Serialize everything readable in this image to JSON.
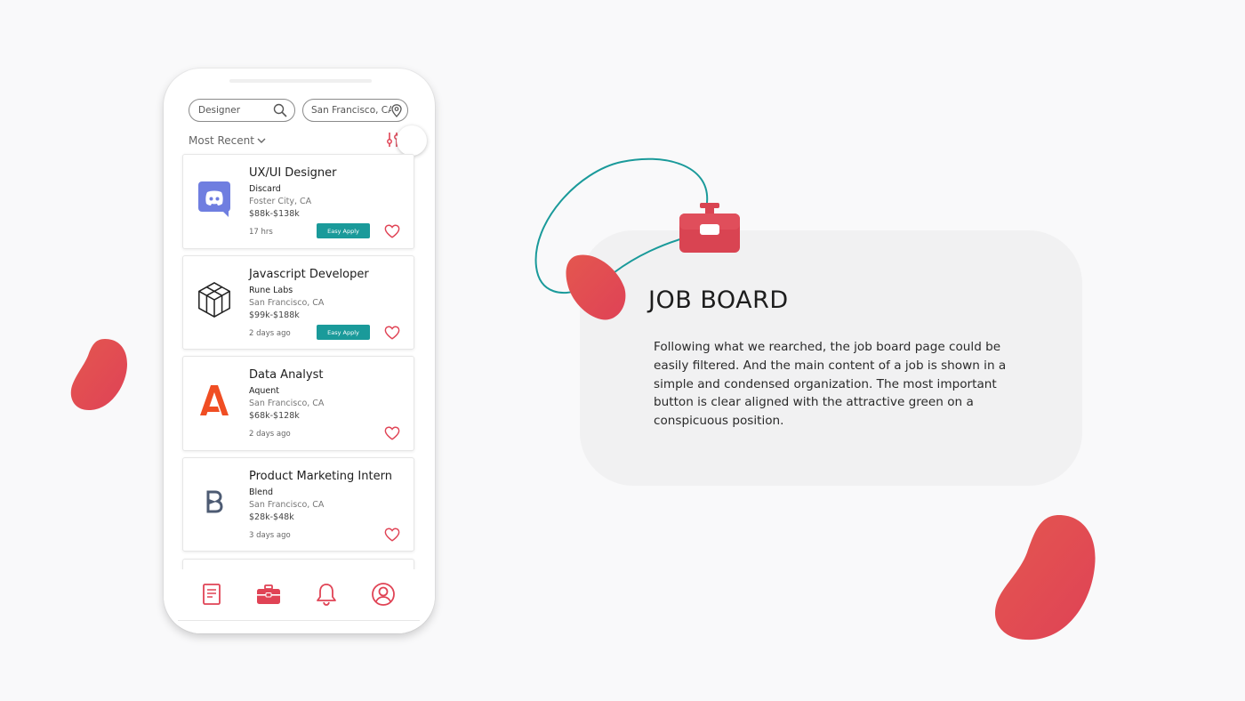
{
  "colors": {
    "accent": "#e04355",
    "teal": "#1a9a9a",
    "card_bg": "#f1f1f2"
  },
  "search": {
    "keyword": "Designer",
    "location": "San Francisco, CA"
  },
  "sort": {
    "label": "Most Recent"
  },
  "jobs": [
    {
      "title": "UX/UI Designer",
      "company": "Discard",
      "location": "Foster City, CA",
      "salary": "$88k-$138k",
      "posted": "17 hrs",
      "apply_label": "Easy Apply",
      "logo": "discord-icon"
    },
    {
      "title": "Javascript Developer",
      "company": "Rune Labs",
      "location": "San Francisco, CA",
      "salary": "$99k-$188k",
      "posted": "2 days ago",
      "apply_label": "Easy Apply",
      "logo": "rune-labs-icon"
    },
    {
      "title": "Data Analyst",
      "company": "Aquent",
      "location": "San Francisco, CA",
      "salary": "$68k-$128k",
      "posted": "2 days ago",
      "logo": "aquent-icon"
    },
    {
      "title": "Product Marketing Intern",
      "company": "Blend",
      "location": "San Francisco, CA",
      "salary": "$28k-$48k",
      "posted": "3 days ago",
      "logo": "blend-icon"
    }
  ],
  "nav": [
    "document-icon",
    "briefcase-icon",
    "bell-icon",
    "profile-icon"
  ],
  "info": {
    "title": "JOB BOARD",
    "body": "Following what we rearched, the job board page could be easily filtered. And the main content of a job is shown in a simple and condensed organization. The most important button is clear aligned with the attractive green on a conspicuous position."
  }
}
